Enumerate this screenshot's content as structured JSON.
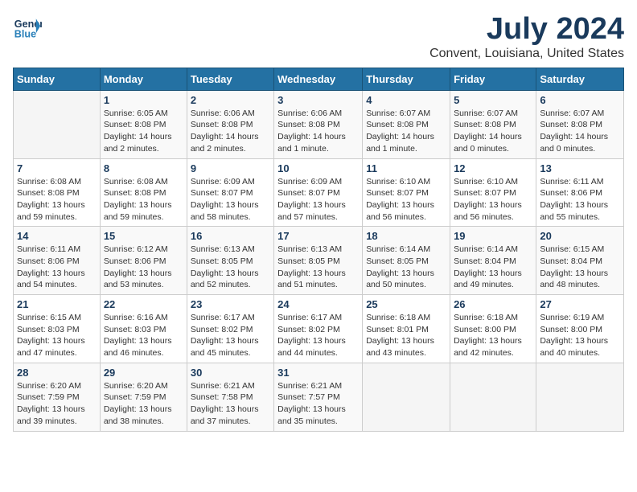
{
  "header": {
    "logo_line1": "General",
    "logo_line2": "Blue",
    "month_year": "July 2024",
    "location": "Convent, Louisiana, United States"
  },
  "weekdays": [
    "Sunday",
    "Monday",
    "Tuesday",
    "Wednesday",
    "Thursday",
    "Friday",
    "Saturday"
  ],
  "weeks": [
    [
      {
        "day": "",
        "info": ""
      },
      {
        "day": "1",
        "info": "Sunrise: 6:05 AM\nSunset: 8:08 PM\nDaylight: 14 hours\nand 2 minutes."
      },
      {
        "day": "2",
        "info": "Sunrise: 6:06 AM\nSunset: 8:08 PM\nDaylight: 14 hours\nand 2 minutes."
      },
      {
        "day": "3",
        "info": "Sunrise: 6:06 AM\nSunset: 8:08 PM\nDaylight: 14 hours\nand 1 minute."
      },
      {
        "day": "4",
        "info": "Sunrise: 6:07 AM\nSunset: 8:08 PM\nDaylight: 14 hours\nand 1 minute."
      },
      {
        "day": "5",
        "info": "Sunrise: 6:07 AM\nSunset: 8:08 PM\nDaylight: 14 hours\nand 0 minutes."
      },
      {
        "day": "6",
        "info": "Sunrise: 6:07 AM\nSunset: 8:08 PM\nDaylight: 14 hours\nand 0 minutes."
      }
    ],
    [
      {
        "day": "7",
        "info": "Sunrise: 6:08 AM\nSunset: 8:08 PM\nDaylight: 13 hours\nand 59 minutes."
      },
      {
        "day": "8",
        "info": "Sunrise: 6:08 AM\nSunset: 8:08 PM\nDaylight: 13 hours\nand 59 minutes."
      },
      {
        "day": "9",
        "info": "Sunrise: 6:09 AM\nSunset: 8:07 PM\nDaylight: 13 hours\nand 58 minutes."
      },
      {
        "day": "10",
        "info": "Sunrise: 6:09 AM\nSunset: 8:07 PM\nDaylight: 13 hours\nand 57 minutes."
      },
      {
        "day": "11",
        "info": "Sunrise: 6:10 AM\nSunset: 8:07 PM\nDaylight: 13 hours\nand 56 minutes."
      },
      {
        "day": "12",
        "info": "Sunrise: 6:10 AM\nSunset: 8:07 PM\nDaylight: 13 hours\nand 56 minutes."
      },
      {
        "day": "13",
        "info": "Sunrise: 6:11 AM\nSunset: 8:06 PM\nDaylight: 13 hours\nand 55 minutes."
      }
    ],
    [
      {
        "day": "14",
        "info": "Sunrise: 6:11 AM\nSunset: 8:06 PM\nDaylight: 13 hours\nand 54 minutes."
      },
      {
        "day": "15",
        "info": "Sunrise: 6:12 AM\nSunset: 8:06 PM\nDaylight: 13 hours\nand 53 minutes."
      },
      {
        "day": "16",
        "info": "Sunrise: 6:13 AM\nSunset: 8:05 PM\nDaylight: 13 hours\nand 52 minutes."
      },
      {
        "day": "17",
        "info": "Sunrise: 6:13 AM\nSunset: 8:05 PM\nDaylight: 13 hours\nand 51 minutes."
      },
      {
        "day": "18",
        "info": "Sunrise: 6:14 AM\nSunset: 8:05 PM\nDaylight: 13 hours\nand 50 minutes."
      },
      {
        "day": "19",
        "info": "Sunrise: 6:14 AM\nSunset: 8:04 PM\nDaylight: 13 hours\nand 49 minutes."
      },
      {
        "day": "20",
        "info": "Sunrise: 6:15 AM\nSunset: 8:04 PM\nDaylight: 13 hours\nand 48 minutes."
      }
    ],
    [
      {
        "day": "21",
        "info": "Sunrise: 6:15 AM\nSunset: 8:03 PM\nDaylight: 13 hours\nand 47 minutes."
      },
      {
        "day": "22",
        "info": "Sunrise: 6:16 AM\nSunset: 8:03 PM\nDaylight: 13 hours\nand 46 minutes."
      },
      {
        "day": "23",
        "info": "Sunrise: 6:17 AM\nSunset: 8:02 PM\nDaylight: 13 hours\nand 45 minutes."
      },
      {
        "day": "24",
        "info": "Sunrise: 6:17 AM\nSunset: 8:02 PM\nDaylight: 13 hours\nand 44 minutes."
      },
      {
        "day": "25",
        "info": "Sunrise: 6:18 AM\nSunset: 8:01 PM\nDaylight: 13 hours\nand 43 minutes."
      },
      {
        "day": "26",
        "info": "Sunrise: 6:18 AM\nSunset: 8:00 PM\nDaylight: 13 hours\nand 42 minutes."
      },
      {
        "day": "27",
        "info": "Sunrise: 6:19 AM\nSunset: 8:00 PM\nDaylight: 13 hours\nand 40 minutes."
      }
    ],
    [
      {
        "day": "28",
        "info": "Sunrise: 6:20 AM\nSunset: 7:59 PM\nDaylight: 13 hours\nand 39 minutes."
      },
      {
        "day": "29",
        "info": "Sunrise: 6:20 AM\nSunset: 7:59 PM\nDaylight: 13 hours\nand 38 minutes."
      },
      {
        "day": "30",
        "info": "Sunrise: 6:21 AM\nSunset: 7:58 PM\nDaylight: 13 hours\nand 37 minutes."
      },
      {
        "day": "31",
        "info": "Sunrise: 6:21 AM\nSunset: 7:57 PM\nDaylight: 13 hours\nand 35 minutes."
      },
      {
        "day": "",
        "info": ""
      },
      {
        "day": "",
        "info": ""
      },
      {
        "day": "",
        "info": ""
      }
    ]
  ]
}
